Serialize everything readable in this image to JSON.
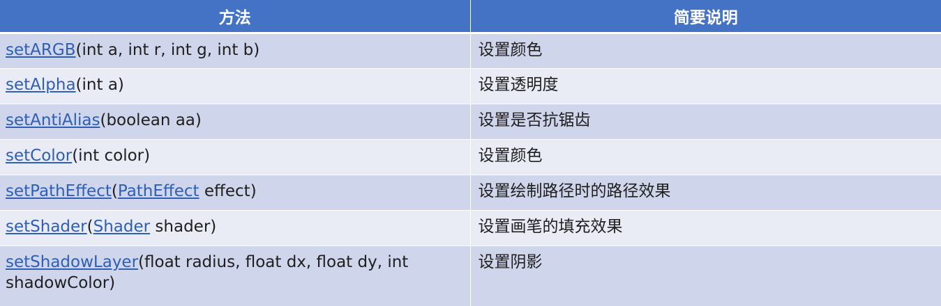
{
  "table": {
    "headers": [
      "方法",
      "简要说明"
    ],
    "rows": [
      {
        "method": "setARGB",
        "params": "(int a, int r, int g, int b)",
        "desc": "设置颜色"
      },
      {
        "method": "setAlpha",
        "params": "(int a)",
        "desc": "设置透明度"
      },
      {
        "method": "setAntiAlias",
        "params": "(boolean aa)",
        "desc": "设置是否抗锯齿"
      },
      {
        "method": "setColor",
        "params": "(int color)",
        "desc": "设置颜色"
      },
      {
        "method": "setPathEffect",
        "pre": "(",
        "type_link": "PathEffect",
        "params": " effect)",
        "desc": "设置绘制路径时的路径效果"
      },
      {
        "method": "setShader",
        "pre": "(",
        "type_link": "Shader",
        "params": " shader)",
        "desc": "设置画笔的填充效果"
      },
      {
        "method": "setShadowLayer",
        "params": "(float radius, float dx, float dy, int shadowColor)",
        "desc": "设置阴影"
      }
    ]
  },
  "colors": {
    "header_bg": "#4472c4",
    "row_dark": "#cfd5ea",
    "row_light": "#e9ebf5",
    "link": "#2e5fb3"
  }
}
